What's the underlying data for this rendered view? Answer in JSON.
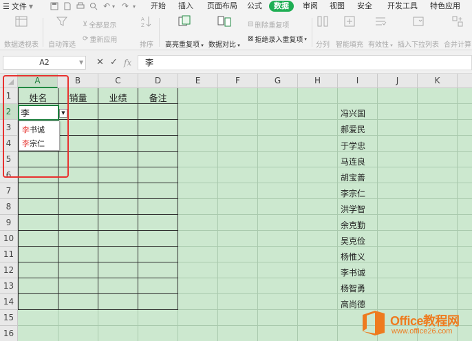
{
  "menubar": {
    "file_label": "文件",
    "tabs": [
      "开始",
      "插入",
      "页面布局",
      "公式",
      "数据",
      "审阅",
      "视图",
      "安全",
      "开发工具",
      "特色应用"
    ],
    "active_tab": "数据"
  },
  "ribbon": {
    "pivot": "数据透视表",
    "autofilter": "自动筛选",
    "show_all": "全部显示",
    "reapply": "重新应用",
    "sort": "排序",
    "highlight_dup": "高亮重复项",
    "compare": "数据对比",
    "delete_dup": "删除重复项",
    "reject_dup": "拒绝录入重复项",
    "split": "分列",
    "smart_fill": "智能填充",
    "validity": "有效性",
    "insert_dropdown": "插入下拉列表",
    "merge_calc": "合并计算"
  },
  "formula_bar": {
    "name_box": "A2",
    "cancel_icon": "✕",
    "confirm_icon": "✓",
    "fx": "fx",
    "formula_value": "李"
  },
  "grid": {
    "columns": [
      "A",
      "B",
      "C",
      "D",
      "E",
      "F",
      "G",
      "H",
      "I",
      "J",
      "K"
    ],
    "active_column": "A",
    "rows": [
      "1",
      "2",
      "3",
      "4",
      "5",
      "6",
      "7",
      "8",
      "9",
      "10",
      "11",
      "12",
      "13",
      "14",
      "15",
      "16"
    ],
    "active_row": "2",
    "headers": [
      "姓名",
      "销量",
      "业绩",
      "备注"
    ],
    "editing_value": "李",
    "names": [
      "冯兴国",
      "郝爱民",
      "于学忠",
      "马连良",
      "胡宝善",
      "李宗仁",
      "洪学智",
      "余克勤",
      "吴克俭",
      "杨惟义",
      "李书诚",
      "杨智勇",
      "高尚德"
    ]
  },
  "autocomplete": [
    {
      "match": "李",
      "rest": "书诚"
    },
    {
      "match": "李",
      "rest": "宗仁"
    }
  ],
  "watermark": {
    "line1": "Office教程网",
    "line2": "www.office26.com"
  },
  "colors": {
    "accent": "#1fae54",
    "grid_bg": "#cce8cf",
    "highlight_box": "#e8312f",
    "watermark": "#ee7b1f"
  }
}
